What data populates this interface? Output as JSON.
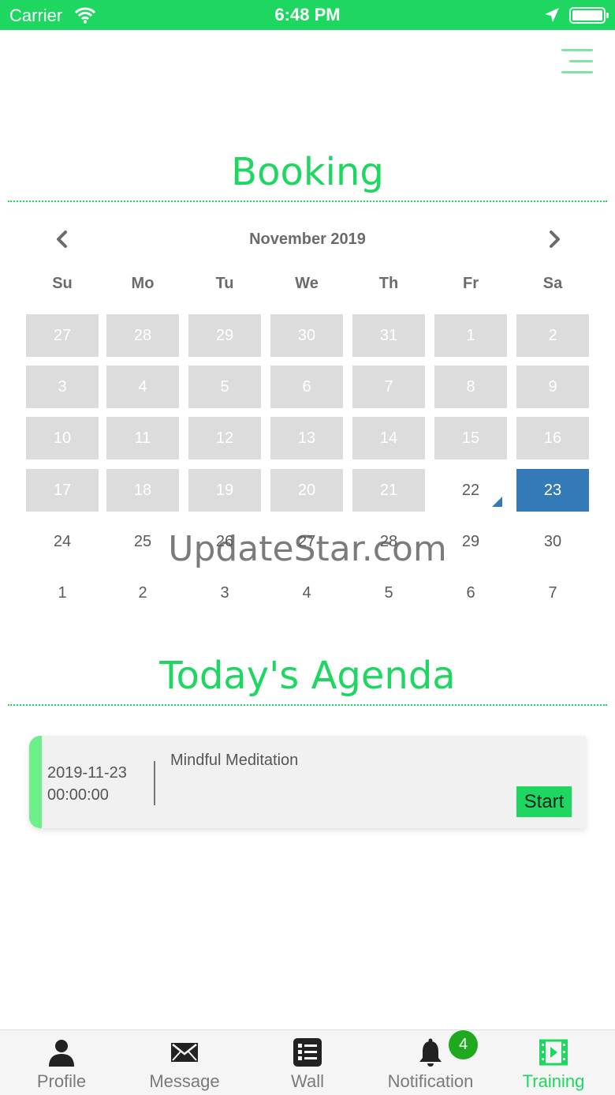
{
  "status_bar": {
    "carrier": "Carrier",
    "time": "6:48 PM"
  },
  "header": {
    "menu_icon": "menu-icon"
  },
  "booking": {
    "title": "Booking",
    "calendar": {
      "month_label": "November 2019",
      "weekdays": [
        "Su",
        "Mo",
        "Tu",
        "We",
        "Th",
        "Fr",
        "Sa"
      ],
      "weeks": [
        [
          {
            "d": "27",
            "s": "disabled"
          },
          {
            "d": "28",
            "s": "disabled"
          },
          {
            "d": "29",
            "s": "disabled"
          },
          {
            "d": "30",
            "s": "disabled"
          },
          {
            "d": "31",
            "s": "disabled"
          },
          {
            "d": "1",
            "s": "disabled"
          },
          {
            "d": "2",
            "s": "disabled"
          }
        ],
        [
          {
            "d": "3",
            "s": "disabled"
          },
          {
            "d": "4",
            "s": "disabled"
          },
          {
            "d": "5",
            "s": "disabled"
          },
          {
            "d": "6",
            "s": "disabled"
          },
          {
            "d": "7",
            "s": "disabled"
          },
          {
            "d": "8",
            "s": "disabled"
          },
          {
            "d": "9",
            "s": "disabled"
          }
        ],
        [
          {
            "d": "10",
            "s": "disabled"
          },
          {
            "d": "11",
            "s": "disabled"
          },
          {
            "d": "12",
            "s": "disabled"
          },
          {
            "d": "13",
            "s": "disabled"
          },
          {
            "d": "14",
            "s": "disabled"
          },
          {
            "d": "15",
            "s": "disabled"
          },
          {
            "d": "16",
            "s": "disabled"
          }
        ],
        [
          {
            "d": "17",
            "s": "disabled"
          },
          {
            "d": "18",
            "s": "disabled"
          },
          {
            "d": "19",
            "s": "disabled"
          },
          {
            "d": "20",
            "s": "disabled"
          },
          {
            "d": "21",
            "s": "disabled"
          },
          {
            "d": "22",
            "s": "today"
          },
          {
            "d": "23",
            "s": "selected"
          }
        ],
        [
          {
            "d": "24",
            "s": "normal"
          },
          {
            "d": "25",
            "s": "normal"
          },
          {
            "d": "26",
            "s": "normal"
          },
          {
            "d": "27",
            "s": "normal"
          },
          {
            "d": "28",
            "s": "normal"
          },
          {
            "d": "29",
            "s": "normal"
          },
          {
            "d": "30",
            "s": "normal"
          }
        ],
        [
          {
            "d": "1",
            "s": "normal"
          },
          {
            "d": "2",
            "s": "normal"
          },
          {
            "d": "3",
            "s": "normal"
          },
          {
            "d": "4",
            "s": "normal"
          },
          {
            "d": "5",
            "s": "normal"
          },
          {
            "d": "6",
            "s": "normal"
          },
          {
            "d": "7",
            "s": "normal"
          }
        ]
      ],
      "selected_color": "#337ab7",
      "disabled_color": "#dcdcdc"
    }
  },
  "watermark": "UpdateStar.com",
  "agenda": {
    "title": "Today's Agenda",
    "items": [
      {
        "date": "2019-11-23",
        "time": "00:00:00",
        "name": "Mindful Meditation",
        "button_label": "Start"
      }
    ]
  },
  "tab_bar": {
    "tabs": [
      {
        "label": "Profile",
        "icon": "person-icon",
        "active": false
      },
      {
        "label": "Message",
        "icon": "envelope-icon",
        "active": false
      },
      {
        "label": "Wall",
        "icon": "list-icon",
        "active": false
      },
      {
        "label": "Notification",
        "icon": "bell-icon",
        "active": false
      },
      {
        "label": "Training",
        "icon": "film-icon",
        "active": true
      }
    ],
    "notification_badge": "4"
  },
  "colors": {
    "accent": "#1ed760",
    "accent_light": "#6df08a",
    "badge": "#1ea91e"
  }
}
